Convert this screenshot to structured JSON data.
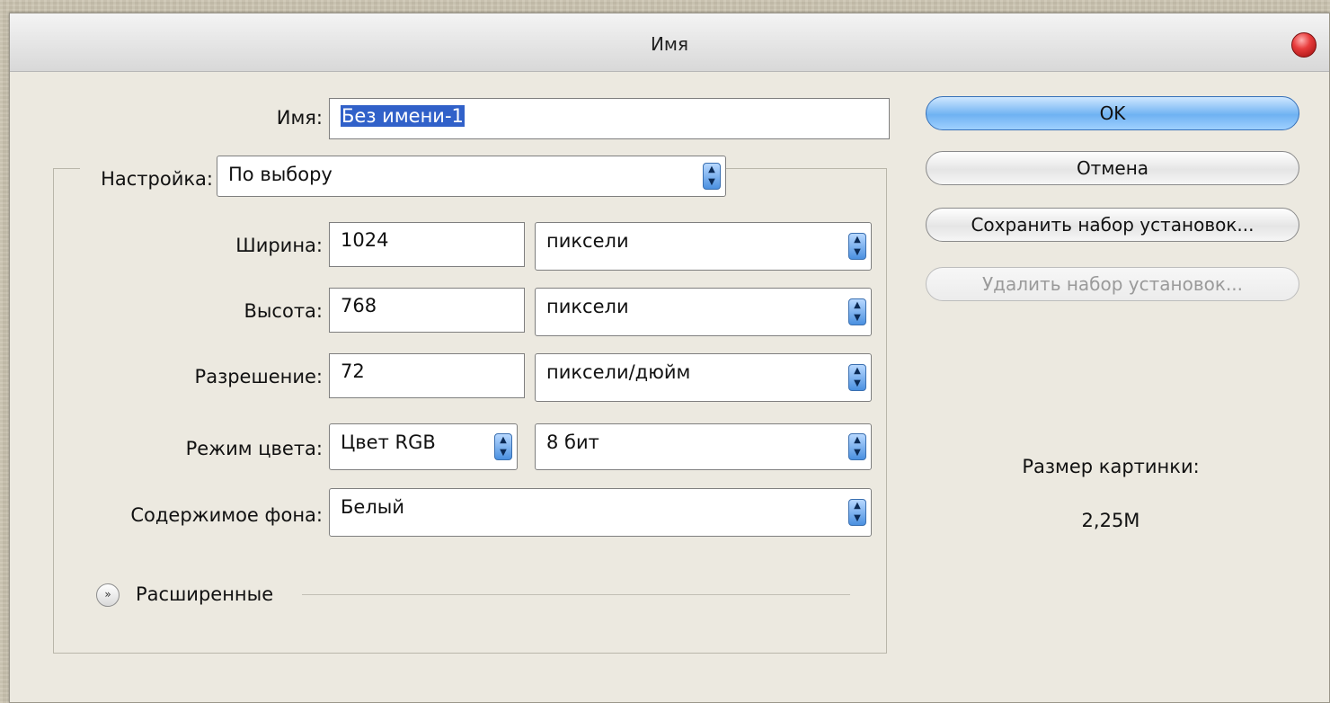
{
  "window": {
    "title": "Имя"
  },
  "form": {
    "name_label": "Имя:",
    "name_value": "Без имени-1",
    "preset_label": "Настройка:",
    "preset_value": "По выбору",
    "width_label": "Ширина:",
    "width_value": "1024",
    "width_unit": "пиксели",
    "height_label": "Высота:",
    "height_value": "768",
    "height_unit": "пиксели",
    "resolution_label": "Разрешение:",
    "resolution_value": "72",
    "resolution_unit": "пиксели/дюйм",
    "color_mode_label": "Режим цвета:",
    "color_mode_value": "Цвет RGB",
    "bit_depth_value": "8 бит",
    "background_label": "Содержимое фона:",
    "background_value": "Белый",
    "advanced_label": "Расширенные"
  },
  "buttons": {
    "ok": "OK",
    "cancel": "Отмена",
    "save_preset": "Сохранить набор установок...",
    "delete_preset": "Удалить набор установок..."
  },
  "info": {
    "image_size_label": "Размер картинки:",
    "image_size_value": "2,25M"
  },
  "icons": {
    "select_arrow": "updown-arrows-icon",
    "advanced_toggle": "chevron-double-down-icon",
    "close": "close-icon"
  },
  "colors": {
    "accent": "#6fb2f2",
    "selection": "#3161c9",
    "close": "#e83c3c"
  }
}
